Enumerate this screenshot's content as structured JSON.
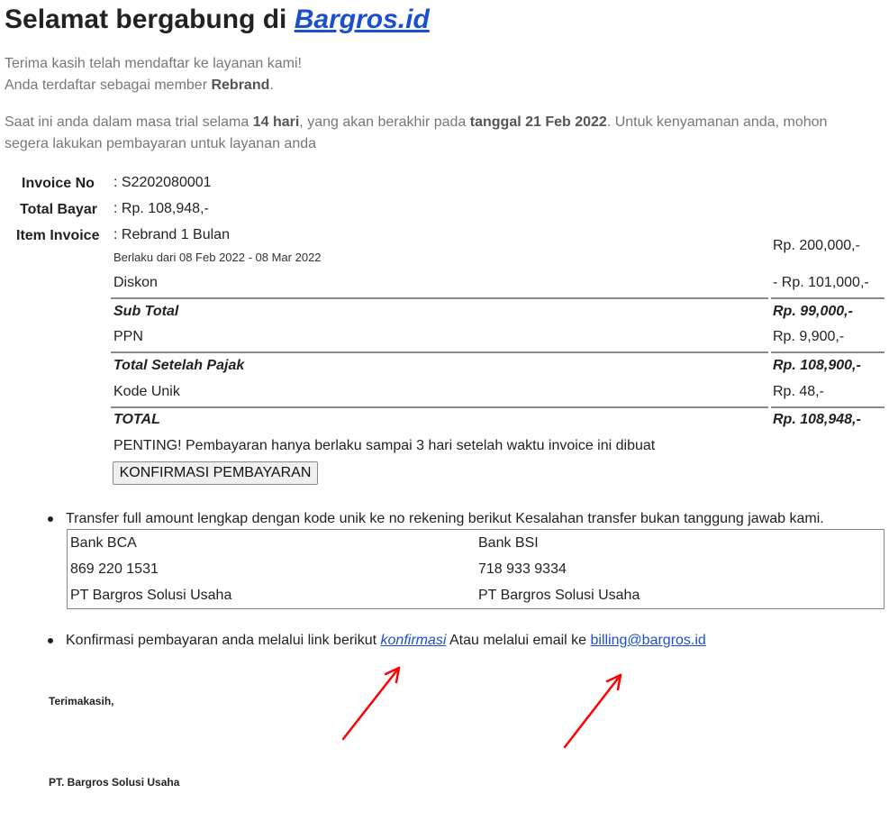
{
  "header": {
    "title_prefix": "Selamat bergabung di",
    "brand_link": "Bargros.id"
  },
  "intro": {
    "line1": "Terima kasih telah mendaftar ke layanan kami!",
    "line2_prefix": "Anda terdaftar sebagai member",
    "member_name": "Rebrand",
    "line2_suffix": "."
  },
  "trial": {
    "part1": "Saat ini anda dalam masa trial selama",
    "days": "14 hari",
    "part2": ", yang akan berakhir pada",
    "end_date": "tanggal 21 Feb 2022",
    "part3": ". Untuk kenyamanan anda, mohon",
    "line2": "segera lakukan pembayaran untuk layanan anda"
  },
  "invoice": {
    "invoice_no_label": "Invoice No",
    "invoice_no": ": S2202080001",
    "total_bayar_label": "Total Bayar",
    "total_bayar": ": Rp. 108,948,-",
    "item_label": "Item Invoice",
    "item_name": ": Rebrand 1 Bulan",
    "item_period": "Berlaku dari 08 Feb 2022 - 08 Mar 2022",
    "item_price": "Rp. 200,000,-",
    "diskon_label": "Diskon",
    "diskon_value": "- Rp. 101,000,-",
    "subtotal_label": "Sub Total",
    "subtotal_value": "Rp. 99,000,-",
    "ppn_label": "PPN",
    "ppn_value": "Rp. 9,900,-",
    "after_tax_label": "Total Setelah Pajak",
    "after_tax_value": "Rp. 108,900,-",
    "kode_unik_label": "Kode Unik",
    "kode_unik_value": "Rp. 48,-",
    "total_label": "TOTAL",
    "total_value": "Rp. 108,948,-",
    "notice": "PENTING! Pembayaran hanya berlaku sampai 3 hari setelah waktu invoice ini dibuat",
    "confirm_button": "KONFIRMASI PEMBAYARAN"
  },
  "transfer": {
    "instruction": "Transfer full amount lengkap dengan kode unik ke no rekening berikut Kesalahan transfer bukan tanggung jawab kami.",
    "banks": [
      {
        "name": "Bank BCA",
        "account": "869 220 1531",
        "holder": "PT Bargros Solusi Usaha"
      },
      {
        "name": "Bank BSI",
        "account": "718 933 9334",
        "holder": "PT Bargros Solusi Usaha"
      }
    ]
  },
  "confirmation": {
    "text_prefix": "Konfirmasi pembayaran anda melalui link berikut",
    "link_label": "konfirmasi",
    "text_middle": "Atau melalui email ke",
    "email": "billing@bargros.id"
  },
  "signature": {
    "thanks": "Terimakasih,",
    "company": "PT. Bargros Solusi Usaha"
  },
  "colors": {
    "link": "#1a4fcf",
    "annotation_arrow": "#ff0000"
  }
}
